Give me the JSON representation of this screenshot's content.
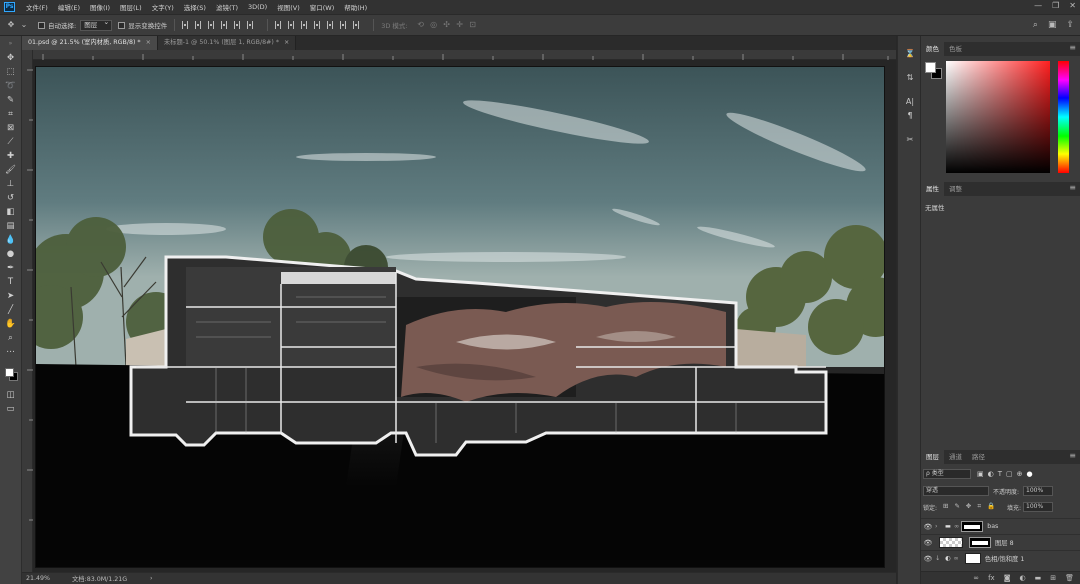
{
  "app": {
    "logo": "Ps"
  },
  "menu": [
    "文件(F)",
    "编辑(E)",
    "图像(I)",
    "图层(L)",
    "文字(Y)",
    "选择(S)",
    "滤镜(T)",
    "3D(D)",
    "视图(V)",
    "窗口(W)",
    "帮助(H)"
  ],
  "window_controls": [
    "—",
    "❐",
    "✕"
  ],
  "options": {
    "auto_select_label": "自动选择:",
    "auto_select_value": "图层",
    "show_transform_label": "显示变换控件",
    "mode_3d_label": "3D 模式:"
  },
  "tabs": [
    {
      "label": "01.psd @ 21.5% (室内材质, RGB/8) *",
      "close": "×"
    },
    {
      "label": "未标题-1 @ 50.1% (图层 1, RGB/8#) *",
      "close": "×"
    }
  ],
  "status": {
    "zoom": "21.49%",
    "doc": "文档:83.0M/1.21G",
    "arrow": "›"
  },
  "color_panel": {
    "tabs": [
      "颜色",
      "色板"
    ],
    "fg": "#ffffff",
    "bg": "#000000"
  },
  "properties_panel": {
    "tabs": [
      "属性",
      "调整"
    ],
    "empty_text": "无属性"
  },
  "layers_panel": {
    "tabs": [
      "图层",
      "通道",
      "路径"
    ],
    "kind_label": "ρ 类型",
    "blend_mode": "穿透",
    "opacity_label": "不透明度:",
    "opacity_value": "100%",
    "lock_label": "锁定:",
    "fill_label": "填充:",
    "fill_value": "100%",
    "layers": [
      {
        "name": "bas",
        "type": "group"
      },
      {
        "name": "图层 8",
        "type": "layer"
      },
      {
        "name": "色相/饱和度 1",
        "type": "adjustment"
      }
    ]
  }
}
